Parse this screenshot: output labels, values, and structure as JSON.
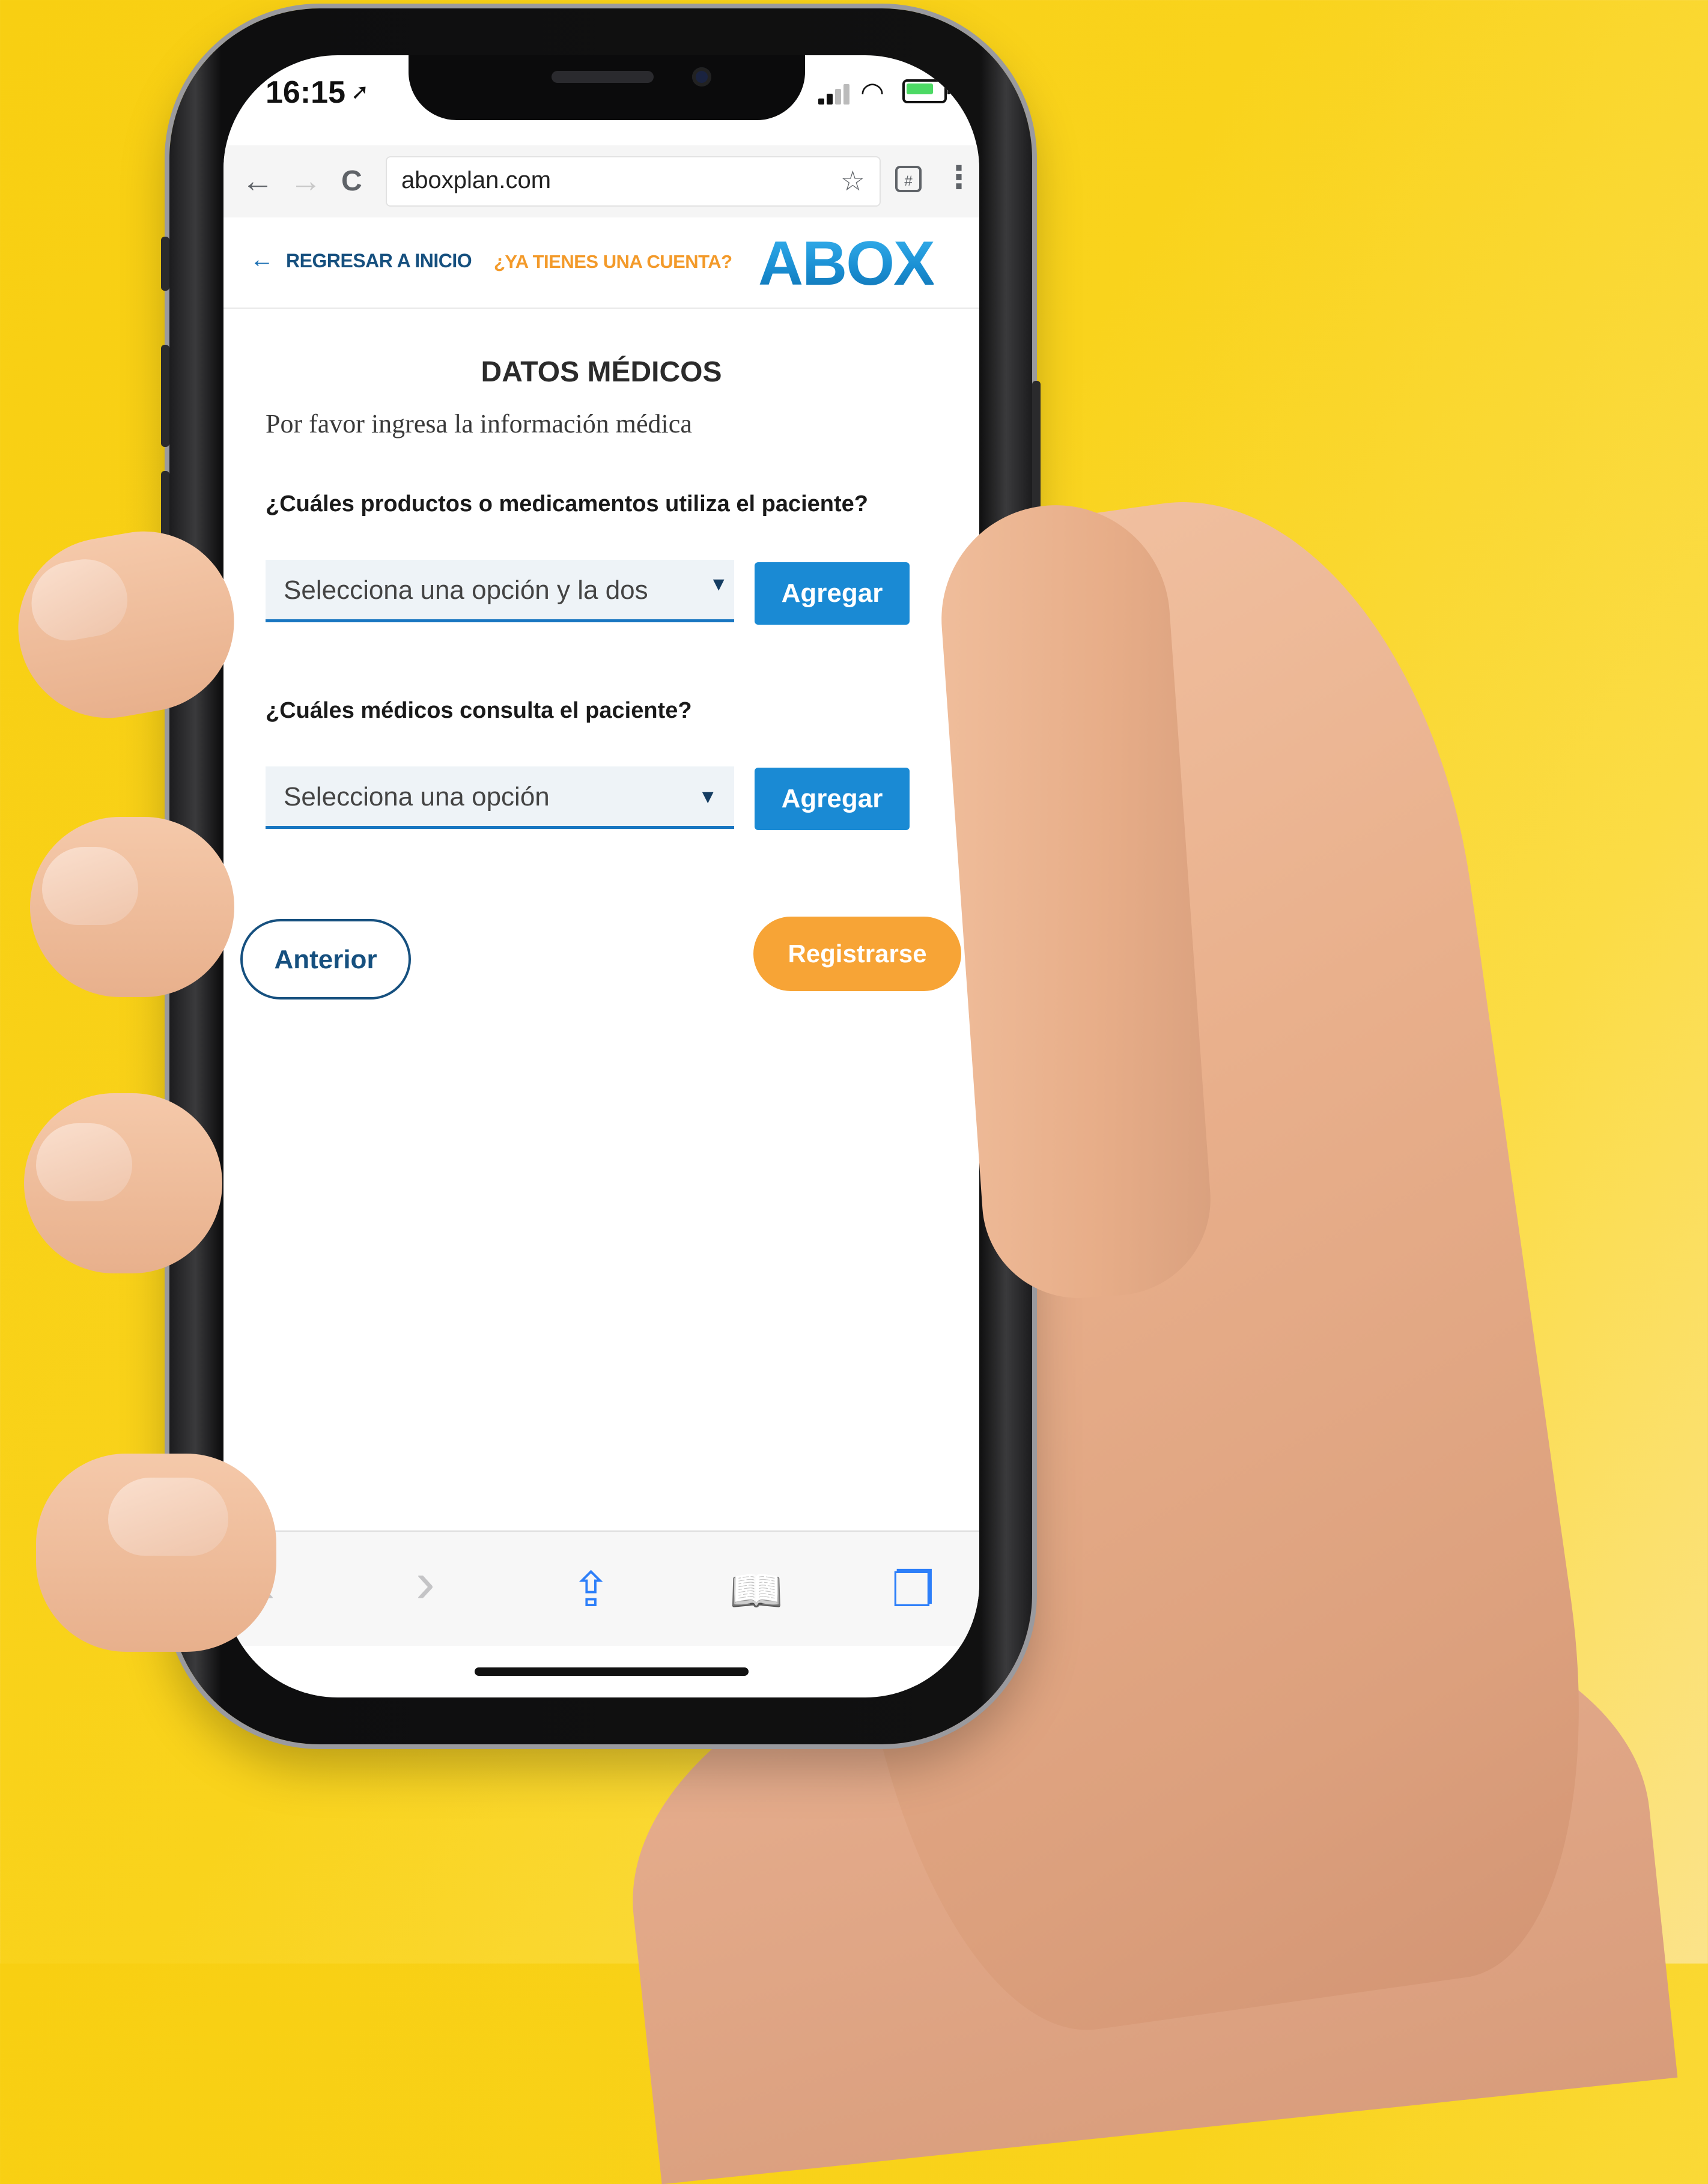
{
  "status_bar": {
    "time": "16:15",
    "location_icon": "location-arrow-icon",
    "signal_icon": "signal-icon",
    "wifi_icon": "wifi-icon",
    "battery_icon": "battery-charging-icon"
  },
  "browser": {
    "back_icon": "←",
    "forward_icon": "→",
    "reload_icon": "C",
    "url": "aboxplan.com",
    "bookmark_icon": "☆",
    "tabs_icon": "#",
    "menu_icon": "⋮"
  },
  "header": {
    "back_arrow": "←",
    "back_label": "REGRESAR A INICIO",
    "account_label": "¿YA TIENES UNA CUENTA?",
    "logo_text": "ABOX"
  },
  "form": {
    "title": "DATOS MÉDICOS",
    "subtitle": "Por favor ingresa la información médica",
    "question_products": "¿Cuáles productos o medicamentos utiliza el paciente?",
    "select_products_value": "Selecciona una opción y la dos",
    "question_doctors": "¿Cuáles médicos consulta el paciente?",
    "select_doctors_value": "Selecciona una opción",
    "caret": "▼",
    "add_label": "Agregar",
    "prev_label": "Anterior",
    "register_label": "Registrarse"
  },
  "toolbar": {
    "back": "‹",
    "forward": "›",
    "share": "⇪",
    "bookmarks": "📖",
    "tabs": "❐"
  },
  "colors": {
    "background": "#f9d31c",
    "brand_blue": "#1a8ad4",
    "dark_blue": "#16507f",
    "accent_orange": "#f7a436"
  }
}
